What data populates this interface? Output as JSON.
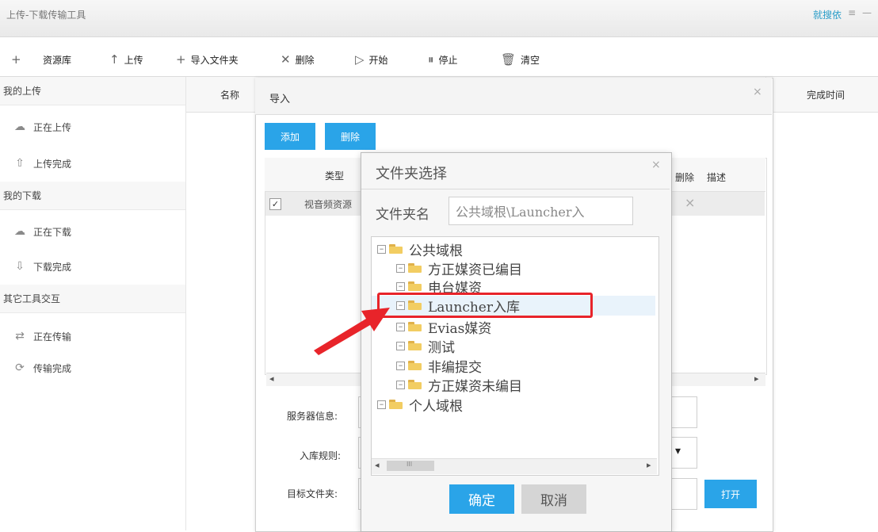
{
  "window": {
    "title": "上传-下载传输工具",
    "user": "就搜依",
    "menu_glyph": "≡",
    "min_glyph": "—"
  },
  "toolbar": {
    "items": [
      {
        "icon": "plus-icon",
        "glyph": "+",
        "label": ""
      },
      {
        "icon": "",
        "glyph": "",
        "label": "资源库"
      },
      {
        "icon": "arrow-up-icon",
        "glyph": "↑",
        "label": "上传"
      },
      {
        "icon": "plus-icon",
        "glyph": "+",
        "label": "导入文件夹"
      },
      {
        "icon": "close-icon",
        "glyph": "✕",
        "label": "删除"
      },
      {
        "icon": "play-icon",
        "glyph": "▷",
        "label": "开始"
      },
      {
        "icon": "pause-icon",
        "glyph": "⏸",
        "label": "停止"
      },
      {
        "icon": "trash-icon",
        "glyph": "🗑",
        "label": "清空"
      }
    ]
  },
  "sidebar": {
    "sections": [
      {
        "title": "我的上传",
        "items": [
          {
            "icon": "cloud-upload-icon",
            "glyph": "☁",
            "label": "正在上传"
          },
          {
            "icon": "upload-done-icon",
            "glyph": "⇧",
            "label": "上传完成"
          }
        ]
      },
      {
        "title": "我的下载",
        "items": [
          {
            "icon": "cloud-download-icon",
            "glyph": "☁",
            "label": "正在下载"
          },
          {
            "icon": "download-done-icon",
            "glyph": "⇩",
            "label": "下载完成"
          }
        ]
      },
      {
        "title": "其它工具交互",
        "items": [
          {
            "icon": "shuffle-icon",
            "glyph": "⇄",
            "label": "正在传输"
          },
          {
            "icon": "transfer-done-icon",
            "glyph": "⟳",
            "label": "传输完成"
          }
        ]
      }
    ]
  },
  "list": {
    "col_name": "名称",
    "col_done": "完成时间"
  },
  "import_dialog": {
    "title": "导入",
    "close_glyph": "×",
    "add_label": "添加",
    "delete_label": "删除",
    "table_headers": {
      "type": "类型",
      "delete": "删除",
      "desc": "描述"
    },
    "row": {
      "checked": "✓",
      "type": "视音频资源",
      "delete_glyph": "×"
    },
    "form": {
      "server_label": "服务器信息:",
      "rule_label": "入库规则:",
      "target_label": "目标文件夹:",
      "open_label": "打开",
      "select_arrow": "▾"
    }
  },
  "folder_dialog": {
    "title": "文件夹选择",
    "close_glyph": "×",
    "name_label": "文件夹名",
    "name_value": "公共域根\\Launcher入",
    "tree": [
      {
        "label": "公共域根",
        "level": 0,
        "exp": "−"
      },
      {
        "label": "方正媒资已编目",
        "level": 1,
        "exp": "−"
      },
      {
        "label": "电台媒资",
        "level": 1,
        "exp": "−"
      },
      {
        "label": "Launcher入库",
        "level": 1,
        "exp": "−",
        "selected": true
      },
      {
        "label": "Evias媒资",
        "level": 1,
        "exp": "−"
      },
      {
        "label": "测试",
        "level": 1,
        "exp": "−"
      },
      {
        "label": "非编提交",
        "level": 1,
        "exp": "−"
      },
      {
        "label": "方正媒资未编目",
        "level": 1,
        "exp": "−"
      },
      {
        "label": "个人域根",
        "level": 0,
        "exp": "−"
      }
    ],
    "scroll_left": "◂",
    "scroll_right": "▸",
    "scroll_grip": "III",
    "ok_label": "确定",
    "cancel_label": "取消"
  },
  "colors": {
    "accent": "#2aa4e8",
    "highlight": "#e8242a"
  }
}
